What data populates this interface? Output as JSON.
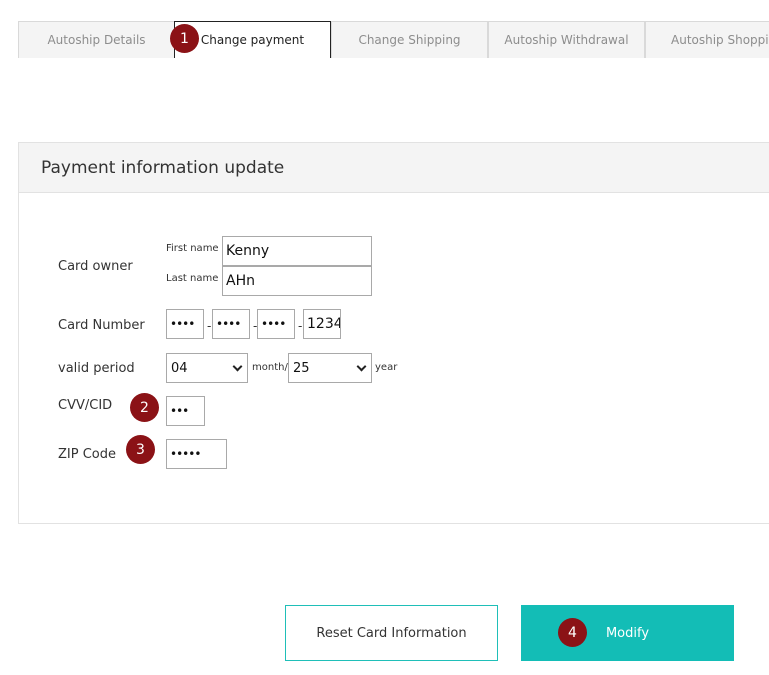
{
  "tabs": [
    {
      "label": "Autoship Details",
      "active": false
    },
    {
      "label": "Change payment",
      "active": true
    },
    {
      "label": "Change Shipping",
      "active": false
    },
    {
      "label": "Autoship Withdrawal",
      "active": false
    },
    {
      "label": "Autoship Shopping",
      "active": false
    }
  ],
  "steps": [
    "1",
    "2",
    "3",
    "4"
  ],
  "panel": {
    "title": "Payment information update",
    "card_owner": {
      "label": "Card owner",
      "first_name_label": "First name",
      "first_name_value": "Kenny",
      "last_name_label": "Last name",
      "last_name_value": "AHn"
    },
    "card_number": {
      "label": "Card Number",
      "parts": [
        "••••",
        "••••",
        "••••",
        "1234"
      ],
      "separator": "-"
    },
    "valid_period": {
      "label": "valid period",
      "month_value": "04",
      "month_suffix": "month/",
      "year_value": "25",
      "year_suffix": "year"
    },
    "cvv": {
      "label": "CVV/CID",
      "value": "•••"
    },
    "zip": {
      "label": "ZIP Code",
      "value": "•••••"
    }
  },
  "buttons": {
    "reset_label": "Reset Card Information",
    "modify_label": "Modify"
  },
  "colors": {
    "accent": "#13bdb6",
    "step_marker": "#8b1216"
  }
}
